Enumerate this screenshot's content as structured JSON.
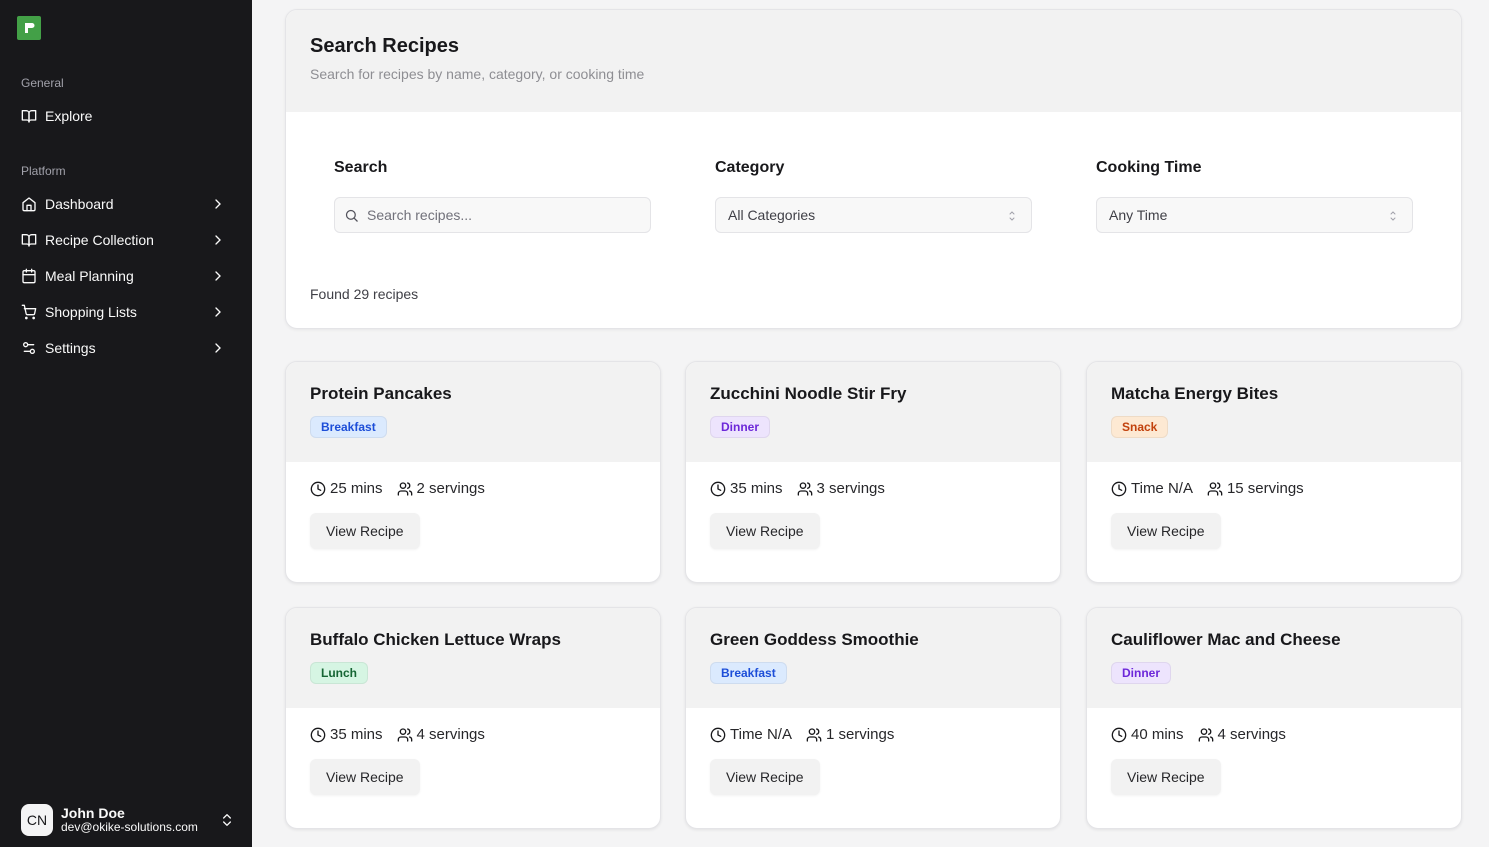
{
  "sidebar": {
    "logo_icon": "app-logo",
    "groups": [
      {
        "label": "General"
      },
      {
        "label": "Platform"
      }
    ],
    "general_items": [
      {
        "label": "Explore",
        "icon": "book-open-icon"
      }
    ],
    "platform_items": [
      {
        "label": "Dashboard",
        "icon": "home-icon"
      },
      {
        "label": "Recipe Collection",
        "icon": "book-open-icon"
      },
      {
        "label": "Meal Planning",
        "icon": "calendar-icon"
      },
      {
        "label": "Shopping Lists",
        "icon": "shopping-cart-icon"
      },
      {
        "label": "Settings",
        "icon": "sliders-icon"
      }
    ],
    "user": {
      "initials": "CN",
      "name": "John Doe",
      "email": "dev@okike-solutions.com"
    }
  },
  "search": {
    "title": "Search Recipes",
    "subtitle": "Search for recipes by name, category, or cooking time",
    "search_label": "Search",
    "search_placeholder": "Search recipes...",
    "search_value": "",
    "category_label": "Category",
    "category_value": "All Categories",
    "time_label": "Cooking Time",
    "time_value": "Any Time",
    "found_text": "Found 29 recipes"
  },
  "badge_colors": {
    "Breakfast": {
      "bg": "#dbeafe",
      "fg": "#1d4ed8"
    },
    "Dinner": {
      "bg": "#ede4fd",
      "fg": "#6d28d9"
    },
    "Snack": {
      "bg": "#fde9d3",
      "fg": "#c2410c"
    },
    "Lunch": {
      "bg": "#d6f5e3",
      "fg": "#166534"
    }
  },
  "recipes": [
    {
      "title": "Protein Pancakes",
      "category": "Breakfast",
      "time": "25 mins",
      "servings": "2 servings",
      "button": "View Recipe"
    },
    {
      "title": "Zucchini Noodle Stir Fry",
      "category": "Dinner",
      "time": "35 mins",
      "servings": "3 servings",
      "button": "View Recipe"
    },
    {
      "title": "Matcha Energy Bites",
      "category": "Snack",
      "time": "Time N/A",
      "servings": "15 servings",
      "button": "View Recipe"
    },
    {
      "title": "Buffalo Chicken Lettuce Wraps",
      "category": "Lunch",
      "time": "35 mins",
      "servings": "4 servings",
      "button": "View Recipe"
    },
    {
      "title": "Green Goddess Smoothie",
      "category": "Breakfast",
      "time": "Time N/A",
      "servings": "1 servings",
      "button": "View Recipe"
    },
    {
      "title": "Cauliflower Mac and Cheese",
      "category": "Dinner",
      "time": "40 mins",
      "servings": "4 servings",
      "button": "View Recipe"
    }
  ]
}
